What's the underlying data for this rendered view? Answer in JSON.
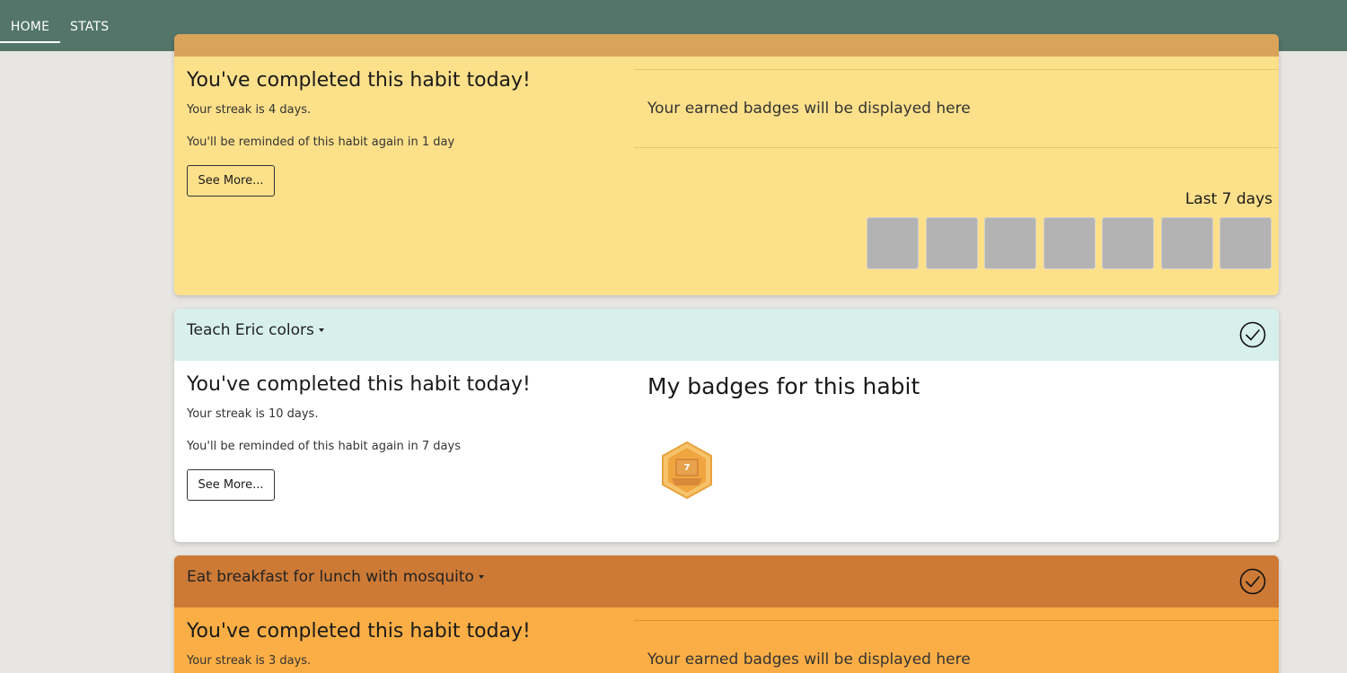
{
  "nav": {
    "home": "HOME",
    "stats": "STATS"
  },
  "habits": [
    {
      "completed": "You've completed this habit today!",
      "streak": "Your streak is 4 days.",
      "remind": "You'll be reminded of this habit again in 1 day",
      "see_more": "See More...",
      "badges_placeholder": "Your earned badges will be displayed here",
      "last7_label": "Last 7 days",
      "last7": [
        false,
        false,
        false,
        false,
        false,
        false,
        false
      ]
    },
    {
      "title": "Teach Eric colors",
      "completed": "You've completed this habit today!",
      "streak": "Your streak is 10 days.",
      "remind": "You'll be reminded of this habit again in 7 days",
      "see_more": "See More...",
      "badges_title": "My badges for this habit",
      "badge_value": "7",
      "badge_icon": "hexagon-badge-icon"
    },
    {
      "title": "Eat breakfast for lunch with mosquito",
      "completed": "You've completed this habit today!",
      "streak": "Your streak is 3 days.",
      "badges_placeholder": "Your earned badges will be displayed here"
    }
  ],
  "colors": {
    "nav": "#53756a",
    "card_yellow": "#fde08a",
    "card_teal_header": "#d7f0eb",
    "card_orange_header": "#cd7a36",
    "card_orange_body": "#fbae45",
    "day_box_empty": "#b3b3b3",
    "badge_gold": "#f0a640"
  }
}
